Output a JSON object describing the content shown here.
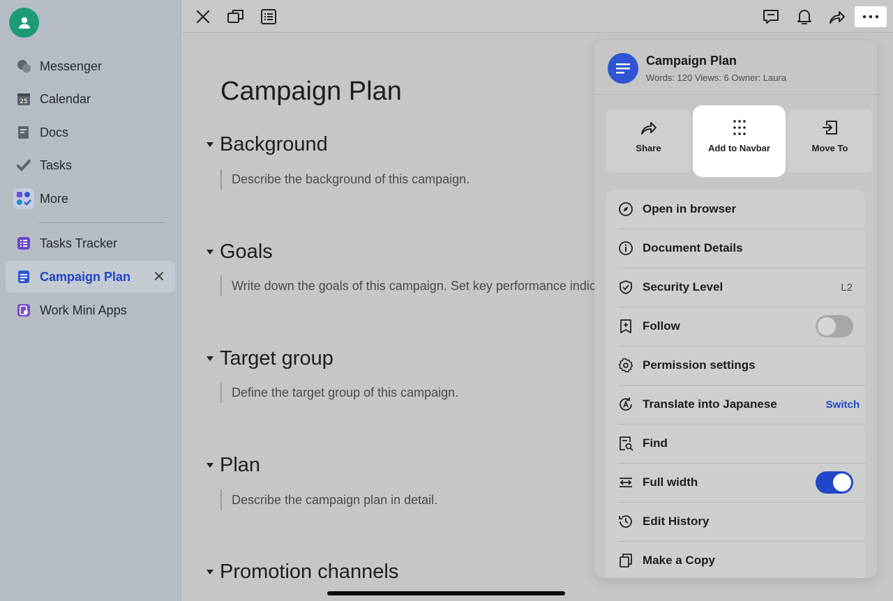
{
  "sidebar": {
    "items": [
      {
        "label": "Messenger",
        "icon": "messenger-icon"
      },
      {
        "label": "Calendar",
        "icon": "calendar-icon",
        "icon_text": "25"
      },
      {
        "label": "Docs",
        "icon": "docs-icon"
      },
      {
        "label": "Tasks",
        "icon": "tasks-icon"
      },
      {
        "label": "More",
        "icon": "more-apps-icon"
      },
      {
        "label": "Tasks Tracker",
        "icon": "tracker-icon"
      },
      {
        "label": "Campaign Plan",
        "icon": "doc-icon",
        "active": true
      },
      {
        "label": "Work Mini Apps",
        "icon": "mini-apps-icon"
      }
    ]
  },
  "toolbar": {
    "left_icons": [
      "close-icon",
      "window-icon",
      "outline-icon"
    ],
    "right_icons": [
      "comment-icon",
      "bell-icon",
      "share-icon",
      "more-icon"
    ]
  },
  "doc": {
    "title": "Campaign Plan",
    "sections": [
      {
        "heading": "Background",
        "text": "Describe the background of this campaign."
      },
      {
        "heading": "Goals",
        "text": "Write down the goals of this campaign. Set key performance indicators"
      },
      {
        "heading": "Target group",
        "text": "Define the target group of this campaign."
      },
      {
        "heading": "Plan",
        "text": "Describe the campaign plan in detail."
      },
      {
        "heading": "Promotion channels",
        "text": ""
      }
    ]
  },
  "panel": {
    "title": "Campaign Plan",
    "meta": "Words: 120  Views: 6  Owner: Laura",
    "actions": [
      {
        "label": "Share",
        "icon": "share-icon"
      },
      {
        "label": "Add to Navbar",
        "icon": "grid-dots-icon",
        "highlighted": true
      },
      {
        "label": "Move To",
        "icon": "move-to-icon"
      }
    ],
    "menu": [
      {
        "label": "Open in browser",
        "icon": "compass-icon"
      },
      {
        "label": "Document Details",
        "icon": "info-icon"
      },
      {
        "label": "Security Level",
        "icon": "shield-icon",
        "right": "L2"
      },
      {
        "label": "Follow",
        "icon": "bookmark-plus-icon",
        "toggle": false
      },
      {
        "label": "Permission settings",
        "icon": "gear-icon"
      },
      {
        "label": "Translate into Japanese",
        "icon": "translate-icon",
        "link": "Switch"
      },
      {
        "label": "Find",
        "icon": "find-icon"
      },
      {
        "label": "Full width",
        "icon": "full-width-icon",
        "toggle": true
      },
      {
        "label": "Edit History",
        "icon": "history-icon"
      },
      {
        "label": "Make a Copy",
        "icon": "copy-icon"
      }
    ]
  },
  "colors": {
    "accent": "#2146c7",
    "avatar": "#1f9a77",
    "doc_badge": "#2f55d4"
  }
}
